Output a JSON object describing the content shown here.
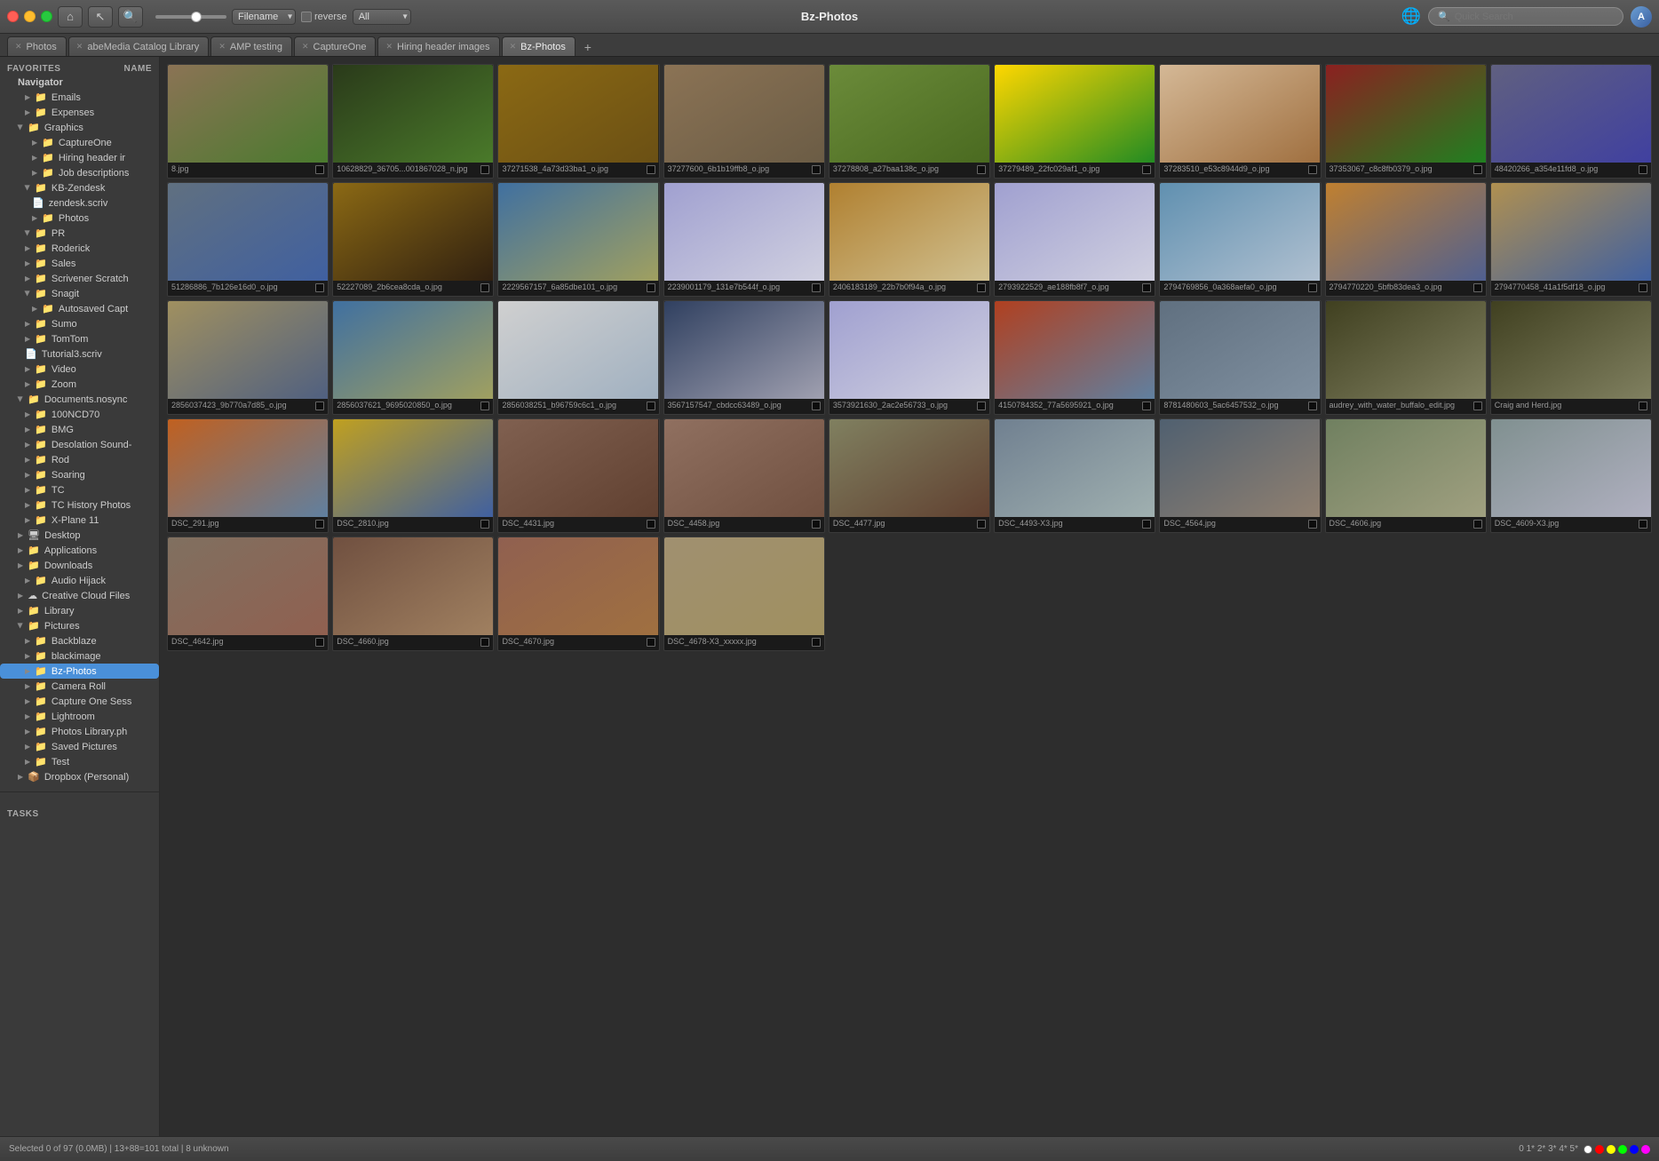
{
  "window": {
    "title": "Bz-Photos"
  },
  "titlebar": {
    "sort_label": "Filename",
    "reverse_label": "reverse",
    "all_label": "All",
    "search_placeholder": "Quick Search",
    "globe_icon": "🌐"
  },
  "tabs": [
    {
      "label": "Photos",
      "active": false,
      "closeable": true
    },
    {
      "label": "abeMedia Catalog Library",
      "active": false,
      "closeable": true
    },
    {
      "label": "AMP testing",
      "active": false,
      "closeable": true
    },
    {
      "label": "CaptureOne",
      "active": false,
      "closeable": true
    },
    {
      "label": "Hiring header images",
      "active": false,
      "closeable": true
    },
    {
      "label": "Bz-Photos",
      "active": true,
      "closeable": true
    }
  ],
  "sidebar": {
    "favorites_label": "Favorites",
    "name_sort": "Name",
    "items": [
      {
        "label": "Emails",
        "indent": 2,
        "type": "folder",
        "expanded": false
      },
      {
        "label": "Expenses",
        "indent": 2,
        "type": "folder",
        "expanded": false
      },
      {
        "label": "Graphics",
        "indent": 1,
        "type": "folder",
        "expanded": true,
        "tri": true
      },
      {
        "label": "CaptureOne",
        "indent": 3,
        "type": "folder",
        "expanded": false
      },
      {
        "label": "Hiring header ir",
        "indent": 3,
        "type": "folder",
        "expanded": false
      },
      {
        "label": "Job descriptions",
        "indent": 3,
        "type": "folder",
        "expanded": false
      },
      {
        "label": "KB-Zendesk",
        "indent": 2,
        "type": "folder",
        "expanded": true,
        "tri": true
      },
      {
        "label": "zendesk.scriv",
        "indent": 3,
        "type": "file",
        "expanded": false
      },
      {
        "label": "Photos",
        "indent": 3,
        "type": "folder",
        "expanded": false
      },
      {
        "label": "PR",
        "indent": 2,
        "type": "folder",
        "expanded": true,
        "tri": true
      },
      {
        "label": "Roderick",
        "indent": 2,
        "type": "folder",
        "expanded": false
      },
      {
        "label": "Sales",
        "indent": 2,
        "type": "folder",
        "expanded": false
      },
      {
        "label": "Scrivener Scratch",
        "indent": 2,
        "type": "folder",
        "expanded": false
      },
      {
        "label": "Snagit",
        "indent": 2,
        "type": "folder",
        "expanded": true,
        "tri": true
      },
      {
        "label": "Autosaved Capt",
        "indent": 3,
        "type": "folder",
        "expanded": false
      },
      {
        "label": "Sumo",
        "indent": 2,
        "type": "folder",
        "expanded": false
      },
      {
        "label": "TomTom",
        "indent": 2,
        "type": "folder",
        "expanded": false
      },
      {
        "label": "Tutorial3.scriv",
        "indent": 2,
        "type": "file",
        "expanded": false
      },
      {
        "label": "Video",
        "indent": 2,
        "type": "folder",
        "expanded": false
      },
      {
        "label": "Zoom",
        "indent": 2,
        "type": "folder",
        "expanded": false
      },
      {
        "label": "Documents.nosync",
        "indent": 1,
        "type": "folder",
        "expanded": true,
        "tri": true
      },
      {
        "label": "100NCD70",
        "indent": 2,
        "type": "folder",
        "expanded": false
      },
      {
        "label": "BMG",
        "indent": 2,
        "type": "folder",
        "expanded": false
      },
      {
        "label": "Desolation Sound-",
        "indent": 2,
        "type": "folder",
        "expanded": false
      },
      {
        "label": "Rod",
        "indent": 2,
        "type": "folder",
        "expanded": false
      },
      {
        "label": "Soaring",
        "indent": 2,
        "type": "folder",
        "expanded": false
      },
      {
        "label": "TC",
        "indent": 2,
        "type": "folder",
        "expanded": false
      },
      {
        "label": "TC History Photos",
        "indent": 2,
        "type": "folder",
        "expanded": false
      },
      {
        "label": "X-Plane 11",
        "indent": 2,
        "type": "folder",
        "expanded": false
      },
      {
        "label": "Desktop",
        "indent": 1,
        "type": "folder",
        "expanded": false
      },
      {
        "label": "Applications",
        "indent": 1,
        "type": "folder",
        "expanded": false
      },
      {
        "label": "Downloads",
        "indent": 1,
        "type": "folder",
        "expanded": false
      },
      {
        "label": "Audio Hijack",
        "indent": 2,
        "type": "folder",
        "expanded": false
      },
      {
        "label": "Creative Cloud Files",
        "indent": 1,
        "type": "folder",
        "expanded": false
      },
      {
        "label": "Library",
        "indent": 1,
        "type": "folder",
        "expanded": false
      },
      {
        "label": "Pictures",
        "indent": 1,
        "type": "folder",
        "expanded": true,
        "tri": true
      },
      {
        "label": "Backblaze",
        "indent": 2,
        "type": "folder",
        "expanded": false
      },
      {
        "label": "blackimage",
        "indent": 2,
        "type": "folder",
        "expanded": false
      },
      {
        "label": "Bz-Photos",
        "indent": 2,
        "type": "folder",
        "expanded": false,
        "selected": true
      },
      {
        "label": "Camera Roll",
        "indent": 2,
        "type": "folder",
        "expanded": false
      },
      {
        "label": "Capture One Sess",
        "indent": 2,
        "type": "folder",
        "expanded": false
      },
      {
        "label": "Lightroom",
        "indent": 2,
        "type": "folder",
        "expanded": false
      },
      {
        "label": "Photos Library.ph",
        "indent": 2,
        "type": "folder",
        "expanded": false
      },
      {
        "label": "Saved Pictures",
        "indent": 2,
        "type": "folder",
        "expanded": false
      },
      {
        "label": "Test",
        "indent": 2,
        "type": "folder",
        "expanded": false
      },
      {
        "label": "Dropbox (Personal)",
        "indent": 1,
        "type": "folder",
        "expanded": false
      }
    ],
    "tasks_label": "Tasks",
    "navigator_label": "Navigator"
  },
  "photos": [
    {
      "filename": "8.jpg",
      "thumb_class": "thumb-bison"
    },
    {
      "filename": "10628829_36705...001867028_n.jpg",
      "thumb_class": "thumb-cow"
    },
    {
      "filename": "37271538_4a73d33ba1_o.jpg",
      "thumb_class": "thumb-camera"
    },
    {
      "filename": "37277600_6b1b19ffb8_o.jpg",
      "thumb_class": "thumb-chair"
    },
    {
      "filename": "37278808_a27baa138c_o.jpg",
      "thumb_class": "thumb-field"
    },
    {
      "filename": "37279489_22fc029af1_o.jpg",
      "thumb_class": "thumb-sunflower"
    },
    {
      "filename": "37283510_e53c8944d9_o.jpg",
      "thumb_class": "thumb-cat"
    },
    {
      "filename": "37353067_c8c8fb0379_o.jpg",
      "thumb_class": "thumb-colorful"
    },
    {
      "filename": "48420266_a354e11fd8_o.jpg",
      "thumb_class": "thumb-building"
    },
    {
      "filename": "51286886_7b126e16d0_o.jpg",
      "thumb_class": "thumb-modern"
    },
    {
      "filename": "52227089_2b6cea8cda_o.jpg",
      "thumb_class": "thumb-workshop"
    },
    {
      "filename": "2229567157_6a85dbe101_o.jpg",
      "thumb_class": "thumb-boat"
    },
    {
      "filename": "2239001179_131e7b544f_o.jpg",
      "thumb_class": "thumb-sailboat"
    },
    {
      "filename": "2406183189_22b7b0f94a_o.jpg",
      "thumb_class": "thumb-classics"
    },
    {
      "filename": "2793922529_ae188fb8f7_o.jpg",
      "thumb_class": "thumb-sailboat"
    },
    {
      "filename": "2794769856_0a368aefa0_o.jpg",
      "thumb_class": "thumb-sf-boats"
    },
    {
      "filename": "2794770220_5bfb83dea3_o.jpg",
      "thumb_class": "thumb-sailing2"
    },
    {
      "filename": "2794770458_41a1f5df18_o.jpg",
      "thumb_class": "thumb-sailing3"
    },
    {
      "filename": "2856037423_9b770a7d85_o.jpg",
      "thumb_class": "thumb-sailrace"
    },
    {
      "filename": "2856037621_9695020850_o.jpg",
      "thumb_class": "thumb-boat"
    },
    {
      "filename": "2856038251_b96759c6c1_o.jpg",
      "thumb_class": "thumb-whitesail"
    },
    {
      "filename": "3567157547_cbdcc63489_o.jpg",
      "thumb_class": "thumb-night"
    },
    {
      "filename": "3573921630_2ac2e56733_o.jpg",
      "thumb_class": "thumb-sailboat"
    },
    {
      "filename": "4150784352_77a5695921_o.jpg",
      "thumb_class": "thumb-redsail"
    },
    {
      "filename": "8781480603_5ac6457532_o.jpg",
      "thumb_class": "thumb-window"
    },
    {
      "filename": "audrey_with_water_buffalo_edit.jpg",
      "thumb_class": "thumb-cows2"
    },
    {
      "filename": "Craig and Herd.jpg",
      "thumb_class": "thumb-cows2"
    },
    {
      "filename": "DSC_291.jpg",
      "thumb_class": "thumb-sailorange"
    },
    {
      "filename": "DSC_2810.jpg",
      "thumb_class": "thumb-boat-yellow"
    },
    {
      "filename": "DSC_4431.jpg",
      "thumb_class": "thumb-ghost-town"
    },
    {
      "filename": "DSC_4458.jpg",
      "thumb_class": "thumb-ghost2"
    },
    {
      "filename": "DSC_4477.jpg",
      "thumb_class": "thumb-barn"
    },
    {
      "filename": "DSC_4493-X3.jpg",
      "thumb_class": "thumb-dsc4493"
    },
    {
      "filename": "DSC_4564.jpg",
      "thumb_class": "thumb-dsc4564"
    },
    {
      "filename": "DSC_4606.jpg",
      "thumb_class": "thumb-dsc4606"
    },
    {
      "filename": "DSC_4609-X3.jpg",
      "thumb_class": "thumb-dsc4609"
    },
    {
      "filename": "DSC_4642.jpg",
      "thumb_class": "thumb-dsc4642"
    },
    {
      "filename": "DSC_4660.jpg",
      "thumb_class": "thumb-dsc4660"
    },
    {
      "filename": "DSC_4670.jpg",
      "thumb_class": "thumb-dsc4670"
    },
    {
      "filename": "DSC_4678-X3_xxxxx.jpg",
      "thumb_class": "thumb-dsc4678"
    }
  ],
  "statusbar": {
    "selected_info": "Selected 0 of 97 (0.0MB) | 13+88=101 total | 8 unknown",
    "rating_display": "0★1★2★3★4★5★",
    "page_indicator": "0 1* 2* 3* 4* 5*"
  }
}
